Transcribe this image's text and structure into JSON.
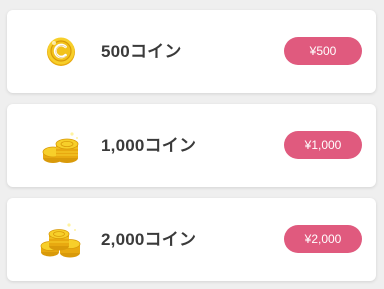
{
  "products": [
    {
      "name": "500コイン",
      "price": "¥500",
      "icon": "single-coin-icon"
    },
    {
      "name": "1,000コイン",
      "price": "¥1,000",
      "icon": "coin-stack-icon"
    },
    {
      "name": "2,000コイン",
      "price": "¥2,000",
      "icon": "coin-pile-icon"
    }
  ],
  "colors": {
    "background": "#efefef",
    "card": "#ffffff",
    "price_button": "#e05a7e",
    "text": "#3a3a3a",
    "coin_gold": "#f2c21b"
  }
}
